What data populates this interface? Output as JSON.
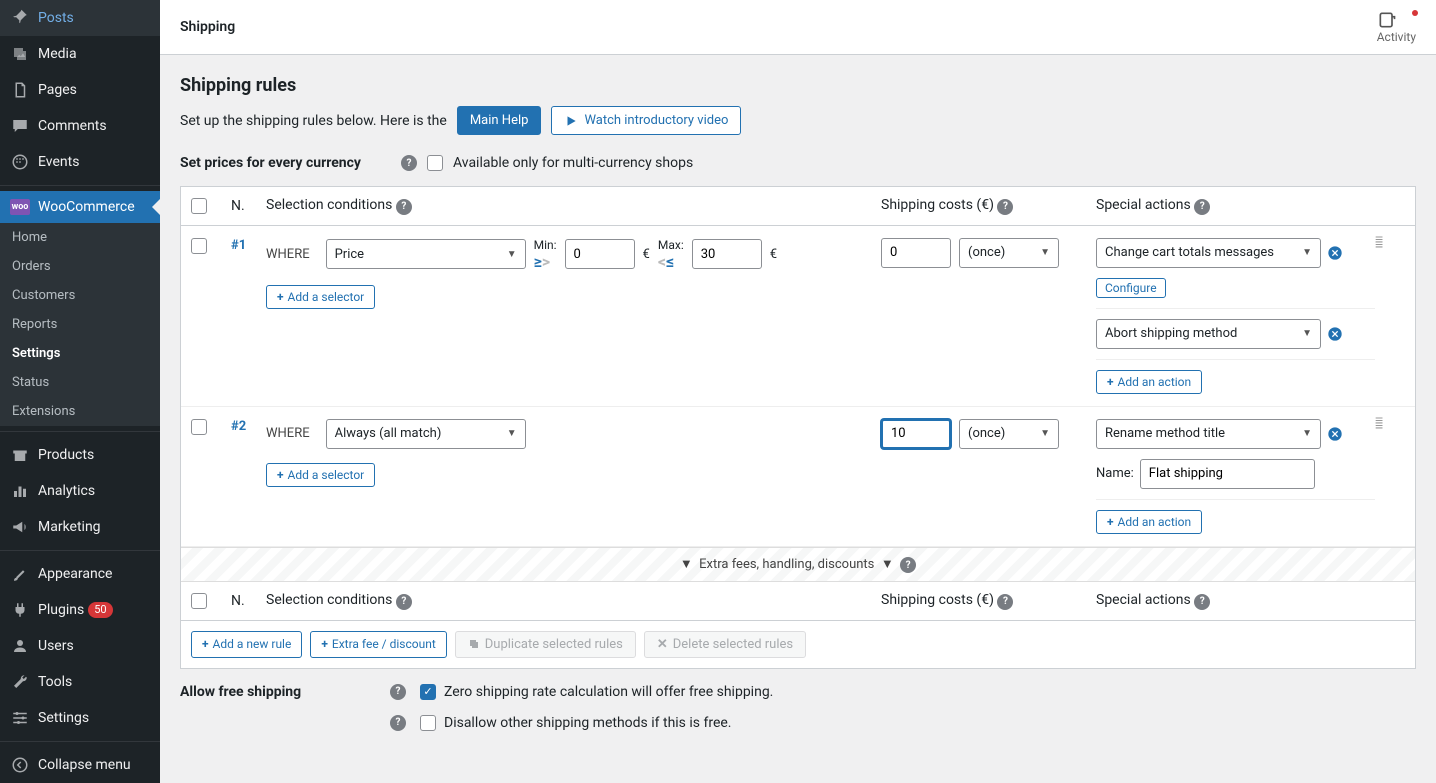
{
  "sidebar": {
    "items": [
      {
        "label": "Posts"
      },
      {
        "label": "Media"
      },
      {
        "label": "Pages"
      },
      {
        "label": "Comments"
      },
      {
        "label": "Events"
      }
    ],
    "woo": {
      "label": "WooCommerce"
    },
    "wooSub": [
      {
        "label": "Home"
      },
      {
        "label": "Orders"
      },
      {
        "label": "Customers"
      },
      {
        "label": "Reports"
      },
      {
        "label": "Settings"
      },
      {
        "label": "Status"
      },
      {
        "label": "Extensions"
      }
    ],
    "items2": [
      {
        "label": "Products"
      },
      {
        "label": "Analytics"
      },
      {
        "label": "Marketing"
      }
    ],
    "items3": [
      {
        "label": "Appearance"
      },
      {
        "label": "Plugins",
        "badge": "50"
      },
      {
        "label": "Users"
      },
      {
        "label": "Tools"
      },
      {
        "label": "Settings"
      }
    ],
    "collapse": "Collapse menu"
  },
  "topbar": {
    "title": "Shipping",
    "activity": "Activity"
  },
  "content": {
    "title": "Shipping rules",
    "intro": "Set up the shipping rules below. Here is the",
    "mainHelp": "Main Help",
    "watchVideo": "Watch introductory video",
    "setPrices": "Set prices for every currency",
    "multiCurrency": "Available only for multi-currency shops",
    "headers": {
      "n": "N.",
      "selection": "Selection conditions",
      "shipping": "Shipping costs (€)",
      "special": "Special actions"
    },
    "rules": [
      {
        "n": "#1",
        "where": "WHERE",
        "selector": "Price",
        "minLabel": "Min:",
        "minVal": "0",
        "maxLabel": "Max:",
        "maxVal": "30",
        "cur": "€",
        "cost": "0",
        "freq": "(once)",
        "actions": [
          {
            "type": "select",
            "value": "Change cart totals messages",
            "extra": "Configure"
          },
          {
            "type": "select",
            "value": "Abort shipping method"
          }
        ]
      },
      {
        "n": "#2",
        "where": "WHERE",
        "selector": "Always (all match)",
        "cost": "10",
        "costFocused": true,
        "freq": "(once)",
        "actions": [
          {
            "type": "select",
            "value": "Rename method title",
            "nameLabel": "Name:",
            "nameValue": "Flat shipping"
          }
        ]
      }
    ],
    "addSelector": "Add a selector",
    "addAction": "Add an action",
    "extraFees": "Extra fees, handling, discounts",
    "footer": {
      "addRule": "Add a new rule",
      "extraFee": "Extra fee / discount",
      "duplicate": "Duplicate selected rules",
      "delete": "Delete selected rules"
    },
    "freeShipping": {
      "label": "Allow free shipping",
      "opt1": "Zero shipping rate calculation will offer free shipping.",
      "opt2": "Disallow other shipping methods if this is free."
    }
  }
}
